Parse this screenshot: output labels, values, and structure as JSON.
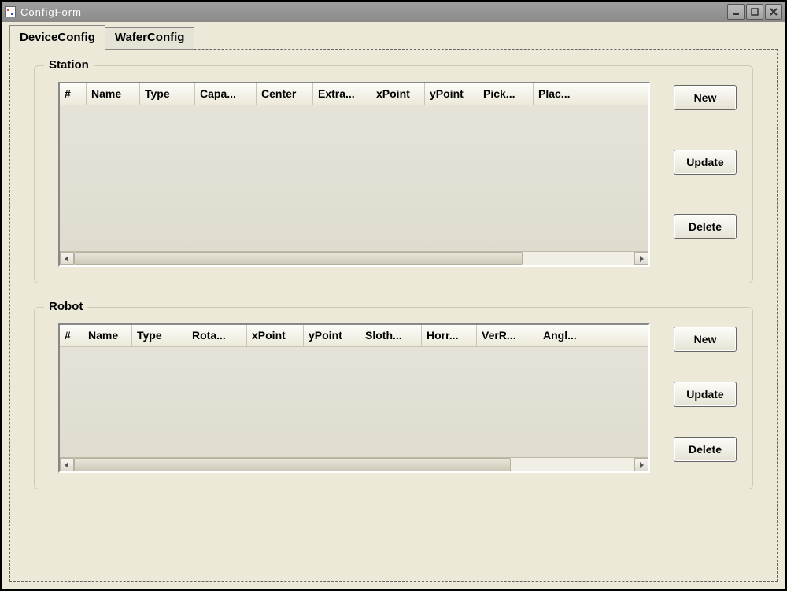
{
  "window": {
    "title": "ConfigForm"
  },
  "tabs": [
    {
      "label": "DeviceConfig",
      "active": true
    },
    {
      "label": "WaferConfig",
      "active": false
    }
  ],
  "groups": {
    "station": {
      "title": "Station",
      "columns": [
        "#",
        "Name",
        "Type",
        "Capa...",
        "Center",
        "Extra...",
        "xPoint",
        "yPoint",
        "Pick...",
        "Plac..."
      ],
      "buttons": {
        "new": "New",
        "update": "Update",
        "delete": "Delete"
      }
    },
    "robot": {
      "title": "Robot",
      "columns": [
        "#",
        "Name",
        "Type",
        "Rota...",
        "xPoint",
        "yPoint",
        "Sloth...",
        "Horr...",
        "VerR...",
        "Angl..."
      ],
      "buttons": {
        "new": "New",
        "update": "Update",
        "delete": "Delete"
      }
    }
  }
}
